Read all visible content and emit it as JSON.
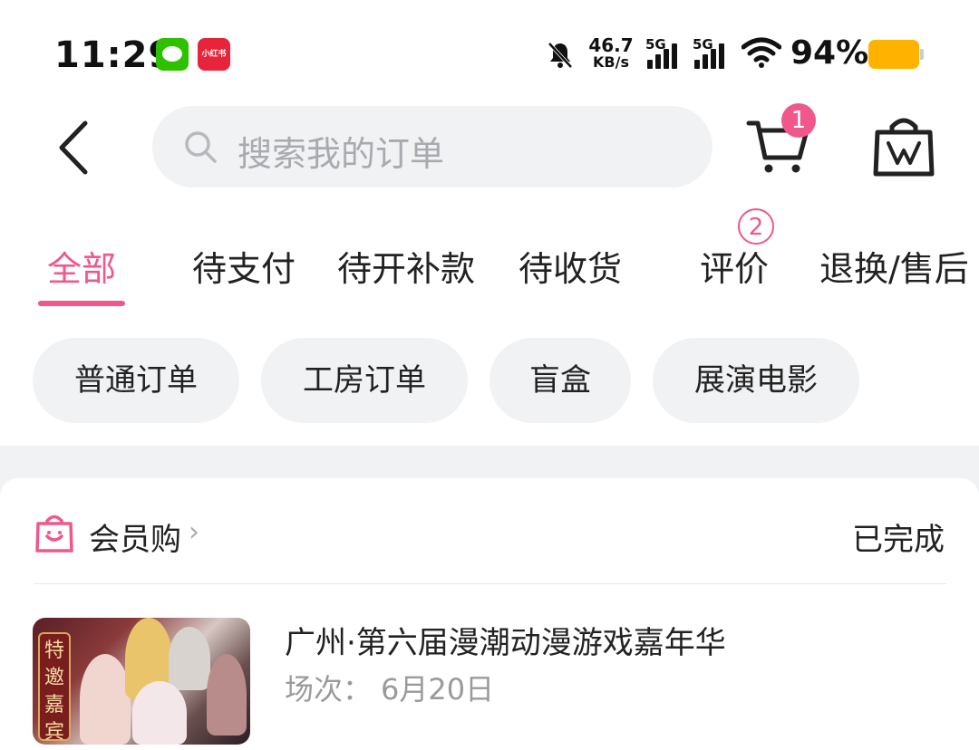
{
  "status_bar": {
    "time": "11:29",
    "apps": [
      "wechat-icon",
      "xiaohongshu-icon"
    ],
    "xhs_label": "小红书",
    "net_speed_value": "46.7",
    "net_speed_unit": "KB/s",
    "signal1_label": "5G",
    "signal2_label": "5G",
    "battery_percent": "94%",
    "battery_color": "#ffb300"
  },
  "header": {
    "search_placeholder": "搜索我的订单",
    "cart_badge_count": "1"
  },
  "tabs": [
    {
      "label": "全部",
      "active": true
    },
    {
      "label": "待支付"
    },
    {
      "label": "待开补款"
    },
    {
      "label": "待收货"
    },
    {
      "label": "评价",
      "badge": "2"
    },
    {
      "label": "退换/售后"
    }
  ],
  "filters": [
    {
      "label": "普通订单"
    },
    {
      "label": "工房订单"
    },
    {
      "label": "盲盒"
    },
    {
      "label": "展演电影"
    }
  ],
  "order": {
    "shop_name": "会员购",
    "chevron": "›",
    "status": "已完成",
    "thumb_badge": "特邀嘉宾",
    "title": "广州·第六届漫潮动漫游戏嘉年华",
    "session_label": "场次：",
    "session_value": "6月20日"
  },
  "colors": {
    "accent": "#f0578a",
    "chip_bg": "#f1f2f4",
    "muted_text": "#9a9a9a"
  }
}
